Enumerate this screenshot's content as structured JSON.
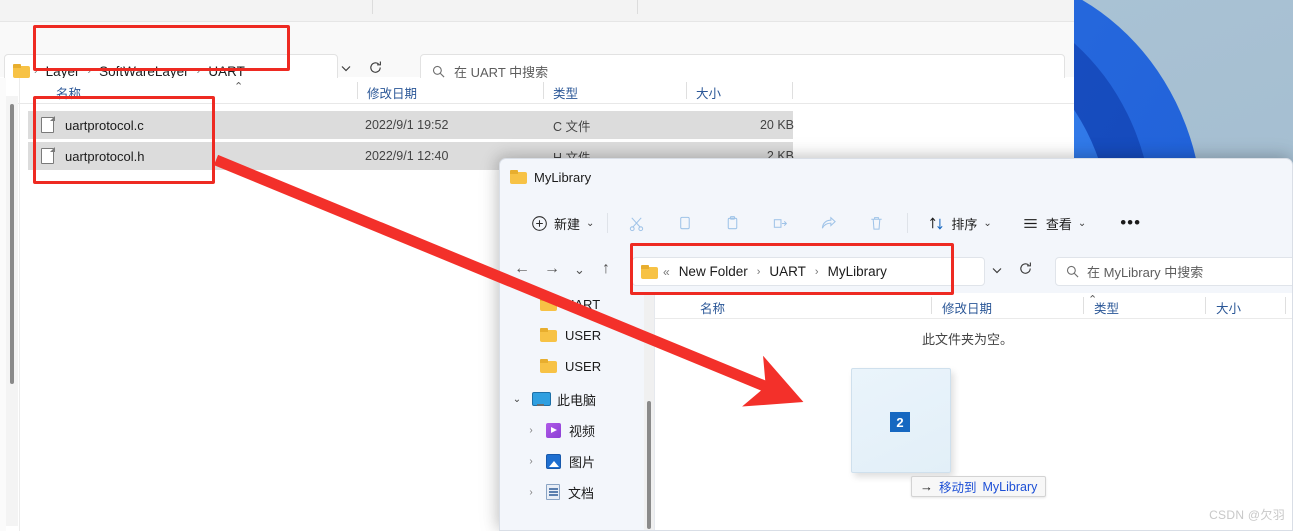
{
  "colors": {
    "annotation_red": "#ee2a22",
    "header_link_blue": "#2b5797",
    "badge_blue": "#1668c1",
    "tooltip_link_blue": "#1c4fd6",
    "selection_gray": "#dcdcdc",
    "folder_yellow": "#f7c245"
  },
  "window_back": {
    "address_bar": {
      "folder_icon": "folder-icon",
      "breadcrumbs": [
        "Layer",
        "SoftWareLayer",
        "UART"
      ],
      "separator": "›",
      "lead_separator": "›",
      "dropdown_icon": "chevron-down-icon",
      "refresh_icon": "refresh-icon",
      "refresh_glyph": "⟳"
    },
    "search": {
      "icon": "search-icon",
      "placeholder": "在 UART 中搜索"
    },
    "columns": [
      {
        "label": "名称"
      },
      {
        "label": "修改日期"
      },
      {
        "label": "类型"
      },
      {
        "label": "大小"
      }
    ],
    "sort_caret": "⌃",
    "files": [
      {
        "name": "uartprotocol.c",
        "date": "2022/9/1 19:52",
        "type": "C 文件",
        "size": "20 KB",
        "icon": "file-icon",
        "selected": true
      },
      {
        "name": "uartprotocol.h",
        "date": "2022/9/1 12:40",
        "type": "H 文件",
        "size": "2 KB",
        "icon": "file-icon",
        "selected": true
      }
    ]
  },
  "window_front": {
    "title": "MyLibrary",
    "title_icon": "folder-icon",
    "toolbar": {
      "new_label": "新建",
      "new_icon": "plus-circle-icon",
      "new_caret": "⌄",
      "cut_icon": "scissors-icon",
      "copy_icon": "copy-icon",
      "paste_icon": "paste-icon",
      "rename_icon": "rename-icon",
      "share_icon": "share-icon",
      "delete_icon": "trash-icon",
      "sort_label": "排序",
      "sort_icon": "sort-arrows-icon",
      "sort_caret": "⌄",
      "view_label": "查看",
      "view_icon": "view-list-icon",
      "view_caret": "⌄",
      "more_icon": "ellipsis-icon",
      "more_label": "•••"
    },
    "nav": {
      "back_icon": "arrow-left-icon",
      "back_glyph": "←",
      "forward_icon": "arrow-right-icon",
      "forward_glyph": "→",
      "recent_icon": "chevron-down-icon",
      "recent_glyph": "⌄",
      "up_icon": "arrow-up-icon",
      "up_glyph": "↑",
      "folder_icon": "folder-icon",
      "overflow": "«",
      "breadcrumbs": [
        "New Folder",
        "UART",
        "MyLibrary"
      ],
      "separator": "›",
      "dropdown_icon": "chevron-down-icon",
      "refresh_icon": "refresh-icon",
      "refresh_glyph": "⟳"
    },
    "search": {
      "icon": "search-icon",
      "placeholder": "在 MyLibrary 中搜索"
    },
    "sidebar": [
      {
        "label": "UART",
        "icon": "folder-icon",
        "indent": 2,
        "chevron": ""
      },
      {
        "label": "USER",
        "icon": "folder-icon",
        "indent": 2,
        "chevron": ""
      },
      {
        "label": "USER",
        "icon": "folder-icon",
        "indent": 2,
        "chevron": ""
      },
      {
        "label": "此电脑",
        "icon": "this-pc-icon",
        "indent": 0,
        "chevron": "⌄"
      },
      {
        "label": "视频",
        "icon": "videos-icon",
        "indent": 1,
        "chevron": "›"
      },
      {
        "label": "图片",
        "icon": "pictures-icon",
        "indent": 1,
        "chevron": "›"
      },
      {
        "label": "文档",
        "icon": "documents-icon",
        "indent": 1,
        "chevron": "›"
      }
    ],
    "columns": [
      {
        "label": "名称"
      },
      {
        "label": "修改日期"
      },
      {
        "label": "类型"
      },
      {
        "label": "大小"
      }
    ],
    "sort_caret": "⌃",
    "empty_message": "此文件夹为空。"
  },
  "drag": {
    "badge_count": "2",
    "tooltip_arrow": "→",
    "tooltip_action": "移动到",
    "tooltip_target": "MyLibrary"
  },
  "watermark": "CSDN @欠羽"
}
